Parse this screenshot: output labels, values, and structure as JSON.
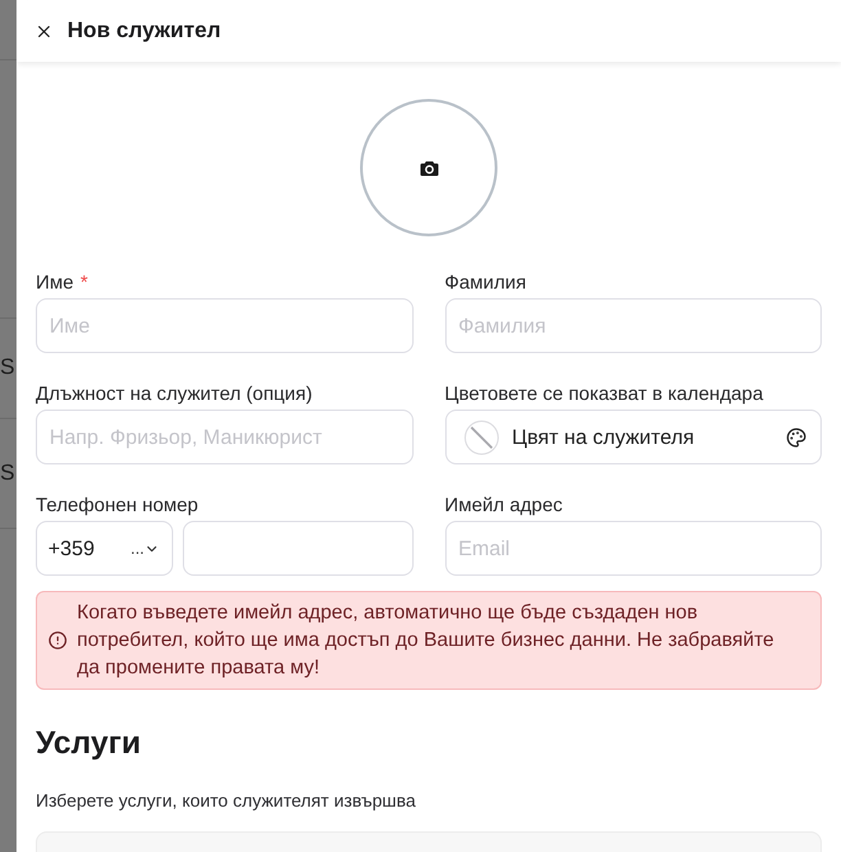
{
  "backdrop": {
    "texts": [
      "S",
      "S"
    ]
  },
  "header": {
    "title": "Нов служител"
  },
  "fields": [
    {
      "kind": "text",
      "label": "Име",
      "required_mark": "*",
      "placeholder": "Име"
    },
    {
      "kind": "text",
      "label": "Фамилия",
      "placeholder": "Фамилия"
    },
    {
      "kind": "text",
      "label": "Длъжност на служител (опция)",
      "placeholder": "Напр. Фризьор, Маникюрист"
    },
    {
      "kind": "color",
      "label": "Цветовете се показват в календара",
      "value": "Цвят на служителя"
    },
    {
      "kind": "phone",
      "label": "Телефонен номер",
      "country_code": "+359",
      "country_more": "..."
    },
    {
      "kind": "text",
      "label": "Имейл адрес",
      "placeholder": "Email"
    }
  ],
  "alert": {
    "kind": "error",
    "text": "Когато въведете имейл адрес, автоматично ще бъде създаден нов потребител, който ще има достъп до Вашите бизнес данни. Не забравяйте да промените правата му!"
  },
  "services": {
    "title": "Услуги",
    "hint": "Изберете услуги, които служителят извършва"
  }
}
